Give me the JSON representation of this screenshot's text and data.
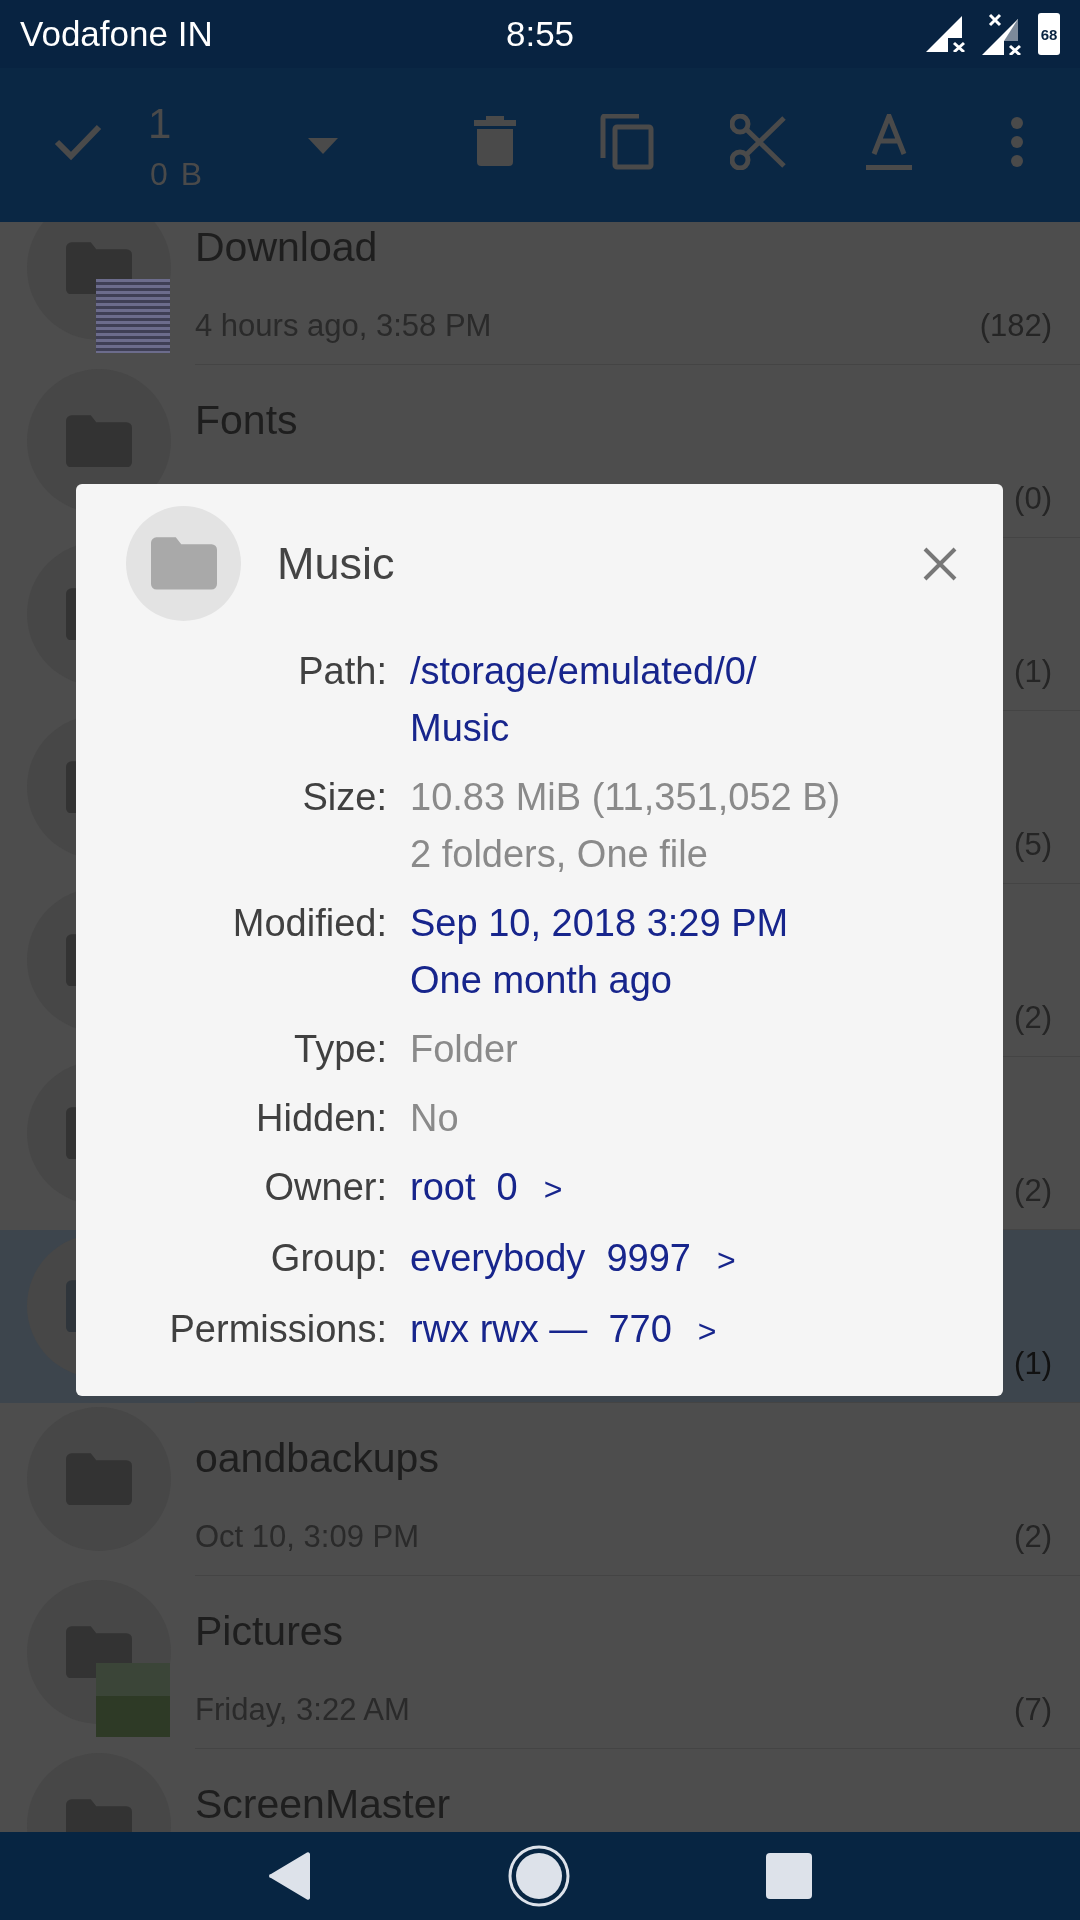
{
  "status_bar": {
    "carrier": "Vodafone IN",
    "time": "8:55",
    "battery": "68"
  },
  "toolbar": {
    "count": "1",
    "size": "0 B"
  },
  "list": [
    {
      "name": "Download",
      "date": "4 hours ago, 3:58 PM",
      "count": "(182)",
      "selected": false,
      "kind": "document"
    },
    {
      "name": "Fonts",
      "count": "(0)",
      "selected": false
    },
    {
      "count": "(1)",
      "selected": false
    },
    {
      "count": "(5)",
      "selected": false
    },
    {
      "count": "(2)",
      "selected": false
    },
    {
      "count": "(2)",
      "selected": false
    },
    {
      "count": "(1)",
      "selected": true
    },
    {
      "name": "oandbackups",
      "date": "Oct 10, 3:09 PM",
      "count": "(2)",
      "selected": false
    },
    {
      "name": "Pictures",
      "date": "Friday, 3:22 AM",
      "count": "(7)",
      "selected": false,
      "kind": "photo"
    },
    {
      "name": "ScreenMaster",
      "selected": false
    }
  ],
  "dialog": {
    "title": "Music",
    "properties": [
      {
        "label": "Path:",
        "kind": "link",
        "lines": [
          "/storage/emulated/0/",
          "Music"
        ]
      },
      {
        "label": "Size:",
        "kind": "plain",
        "lines": [
          "10.83 MiB (11,351,052 B)",
          "2 folders, One file"
        ]
      },
      {
        "label": "Modified:",
        "kind": "link",
        "lines": [
          "Sep 10, 2018 3:29 PM",
          "One month ago"
        ]
      },
      {
        "label": "Type:",
        "kind": "plain",
        "lines": [
          "Folder"
        ]
      },
      {
        "label": "Hidden:",
        "kind": "plain",
        "lines": [
          "No"
        ]
      },
      {
        "label": "Owner:",
        "kind": "link",
        "lines": [
          "root  0"
        ],
        "chevron": ">"
      },
      {
        "label": "Group:",
        "kind": "link",
        "lines": [
          "everybody  9997"
        ],
        "chevron": ">"
      },
      {
        "label": "Permissions:",
        "kind": "link",
        "lines": [
          "rwx rwx —  770"
        ],
        "chevron": ">"
      }
    ]
  }
}
